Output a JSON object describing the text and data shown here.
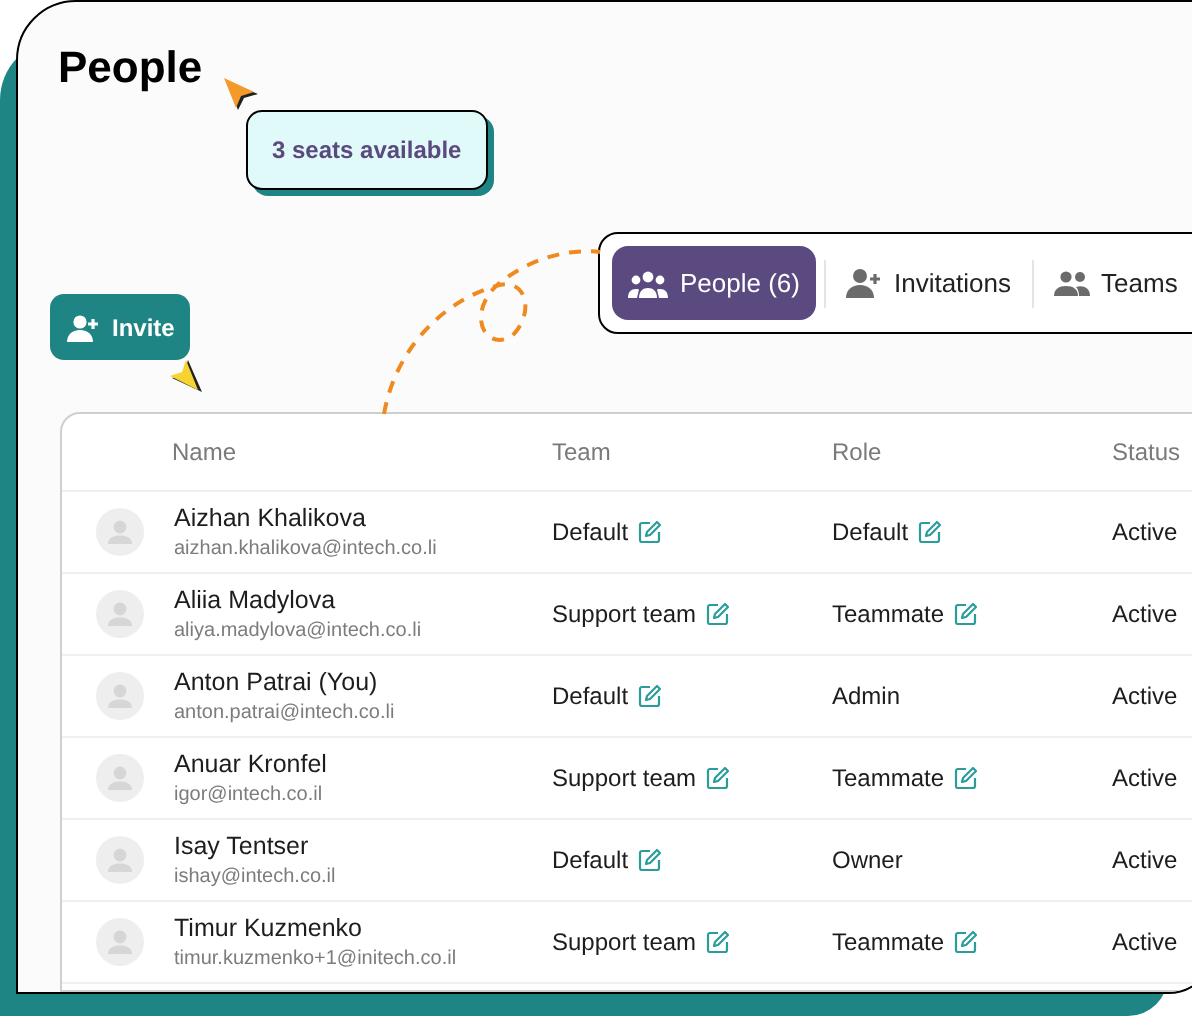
{
  "page_title": "People",
  "seats_badge": "3 seats available",
  "invite_button": "Invite",
  "tabs": [
    {
      "label": "People (6)",
      "selected": true,
      "kind": "people"
    },
    {
      "label": "Invitations",
      "selected": false,
      "kind": "invitations"
    },
    {
      "label": "Teams",
      "selected": false,
      "kind": "teams"
    }
  ],
  "table": {
    "columns": [
      "Name",
      "Team",
      "Role",
      "Status"
    ],
    "rows": [
      {
        "name": "Aizhan Khalikova",
        "email": "aizhan.khalikova@intech.co.li",
        "team": "Default",
        "team_editable": true,
        "role": "Default",
        "role_editable": true,
        "status": "Active"
      },
      {
        "name": "Aliia Madylova",
        "email": "aliya.madylova@intech.co.li",
        "team": "Support team",
        "team_editable": true,
        "role": "Teammate",
        "role_editable": true,
        "status": "Active"
      },
      {
        "name": "Anton Patrai (You)",
        "email": "anton.patrai@intech.co.li",
        "team": "Default",
        "team_editable": true,
        "role": "Admin",
        "role_editable": false,
        "status": "Active"
      },
      {
        "name": "Anuar Kronfel",
        "email": "igor@intech.co.il",
        "team": "Support team",
        "team_editable": true,
        "role": "Teammate",
        "role_editable": true,
        "status": "Active"
      },
      {
        "name": "Isay Tentser",
        "email": "ishay@intech.co.il",
        "team": "Default",
        "team_editable": true,
        "role": "Owner",
        "role_editable": false,
        "status": "Active"
      },
      {
        "name": "Timur Kuzmenko",
        "email": "timur.kuzmenko+1@initech.co.il",
        "team": "Support team",
        "team_editable": true,
        "role": "Teammate",
        "role_editable": true,
        "status": "Active"
      }
    ]
  }
}
